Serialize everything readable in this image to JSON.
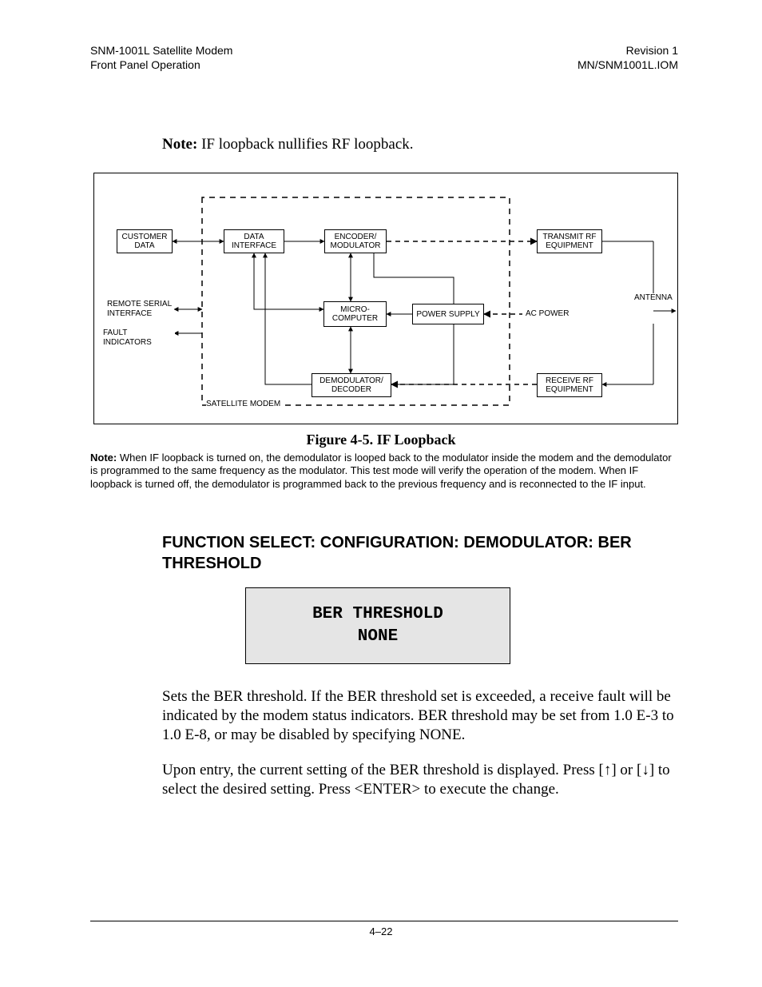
{
  "header": {
    "left_line1": "SNM-1001L Satellite Modem",
    "left_line2": "Front Panel Operation",
    "right_line1": "Revision 1",
    "right_line2": "MN/SNM1001L.IOM"
  },
  "note1": {
    "label": "Note:",
    "text": "IF loopback nullifies RF loopback."
  },
  "diagram": {
    "boxes": {
      "customer_data": "CUSTOMER DATA",
      "data_interface": "DATA INTERFACE",
      "encoder_mod": "ENCODER/ MODULATOR",
      "transmit_rf": "TRANSMIT RF EQUIPMENT",
      "micro": "MICRO- COMPUTER",
      "power_supply": "POWER SUPPLY",
      "demod_decoder": "DEMODULATOR/ DECODER",
      "receive_rf": "RECEIVE RF EQUIPMENT"
    },
    "labels": {
      "remote_serial": "REMOTE SERIAL INTERFACE",
      "fault_indicators": "FAULT INDICATORS",
      "ac_power": "AC POWER",
      "antenna": "ANTENNA",
      "satellite_modem": "SATELLITE MODEM"
    }
  },
  "figure_caption": "Figure 4-5.  IF Loopback",
  "figure_note": {
    "label": "Note:",
    "text": "When IF loopback is turned on, the demodulator is looped back to the modulator inside the modem and the demodulator is programmed to the same frequency as the modulator. This test mode will verify the operation of the modem. When IF loopback is turned off, the demodulator is programmed back to the previous frequency and is reconnected to the IF input."
  },
  "section_heading": "FUNCTION SELECT: CONFIGURATION: DEMODULATOR: BER THRESHOLD",
  "lcd": {
    "line1": "BER THRESHOLD",
    "line2": "NONE"
  },
  "body_para1": "Sets the BER threshold. If the BER threshold set is exceeded, a receive fault will be indicated by the modem status indicators. BER threshold may be set from 1.0 E-3 to 1.0 E-8, or may be disabled by specifying NONE.",
  "body_para2_a": "Upon entry, the current setting of the BER threshold is displayed. Press [",
  "body_para2_b": "] or [",
  "body_para2_c": "] to select the desired setting. Press <ENTER> to execute the change.",
  "arrow_up": "↑",
  "arrow_down": "↓",
  "footer_page": "4–22"
}
